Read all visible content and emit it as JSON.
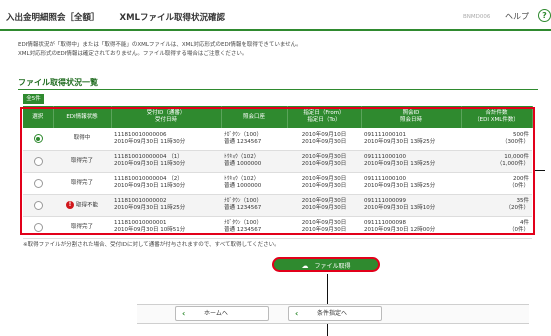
{
  "header": {
    "title": "入出金明細照会［全額］",
    "subtitle": "XMLファイル取得状況確認",
    "screen_id": "BNMD006",
    "help_label": "ヘルプ",
    "help_icon": "question-icon",
    "accent": "#2f8a2f"
  },
  "notice": {
    "line1": "EDI情報状況が「取得中」または「取得不能」のXMLファイルは、XML対応形式のEDI情報を取得できていません。",
    "line2": "XML対応形式のEDI情報は確定されておりません。ファイル取得する場合はご注意ください。"
  },
  "section": {
    "title": "ファイル取得状況一覧",
    "all_badge": "全5件"
  },
  "table": {
    "headers": {
      "select": "選択",
      "status": "EDI情報状態",
      "receipt_line1": "受付ID（通番）",
      "receipt_line2": "受付日時",
      "account": "照会口座",
      "period_line1": "指定日（From）",
      "period_line2": "指定日（To）",
      "inquiry_line1": "照会ID",
      "inquiry_line2": "照会日時",
      "count_line1": "合計件数",
      "count_line2": "（EDI XML件数）"
    },
    "rows": [
      {
        "selected": true,
        "status": "取得中",
        "error": false,
        "receipt_id": "111810010000006",
        "receipt_dt": "2010年09月30日 11時30分",
        "branch": "ﾅｶﾞﾀｳﾝ（100）",
        "account": "普通 1234567",
        "from": "2010年09月10日",
        "to": "2010年09月30日",
        "inquiry_id": "091111000101",
        "inquiry_dt": "2010年09月30日 13時25分",
        "count": "500件",
        "edi_count": "（300件）"
      },
      {
        "selected": false,
        "status": "取得完了",
        "error": false,
        "receipt_id": "111810010000004 （1）",
        "receipt_dt": "2010年09月30日 11時30分",
        "branch": "ﾄｳｷｮｳ（102）",
        "account": "普通 1000000",
        "from": "2010年09月30日",
        "to": "2010年09月30日",
        "inquiry_id": "091111000100",
        "inquiry_dt": "2010年09月30日 13時25分",
        "count": "10,000件",
        "edi_count": "（1,000件）"
      },
      {
        "selected": false,
        "status": "取得完了",
        "error": false,
        "receipt_id": "111810010000004 （2）",
        "receipt_dt": "2010年09月30日 11時30分",
        "branch": "ﾄｳｷｮｳ（102）",
        "account": "普通 1000000",
        "from": "2010年09月30日",
        "to": "2010年09月30日",
        "inquiry_id": "091111000100",
        "inquiry_dt": "2010年09月30日 13時25分",
        "count": "200件",
        "edi_count": "（0件）"
      },
      {
        "selected": false,
        "status": "取得不能",
        "error": true,
        "receipt_id": "111810010000002",
        "receipt_dt": "2010年09月30日 11時25分",
        "branch": "ﾅｶﾞﾀｳﾝ（100）",
        "account": "普通 1234567",
        "from": "2010年09月30日",
        "to": "2010年09月30日",
        "inquiry_id": "091111000099",
        "inquiry_dt": "2010年09月30日 13時10分",
        "count": "35件",
        "edi_count": "（20件）"
      },
      {
        "selected": false,
        "status": "取得完了",
        "error": false,
        "receipt_id": "111810010000001",
        "receipt_dt": "2010年09月30日 10時51分",
        "branch": "ﾅｶﾞﾀｳﾝ（100）",
        "account": "普通 1234567",
        "from": "2010年09月30日",
        "to": "2010年09月30日",
        "inquiry_id": "091111000098",
        "inquiry_dt": "2010年09月30日 12時00分",
        "count": "4件",
        "edi_count": "（0件）"
      }
    ]
  },
  "footnote": "※取得ファイルが分割された場合、受付IDに対して通番が付与されますので、すべて取得してください。",
  "actions": {
    "fetch_label": "ファイル取得",
    "fetch_icon": "cloud-download-icon",
    "home_label": "ホームへ",
    "back_label": "条件指定へ"
  }
}
